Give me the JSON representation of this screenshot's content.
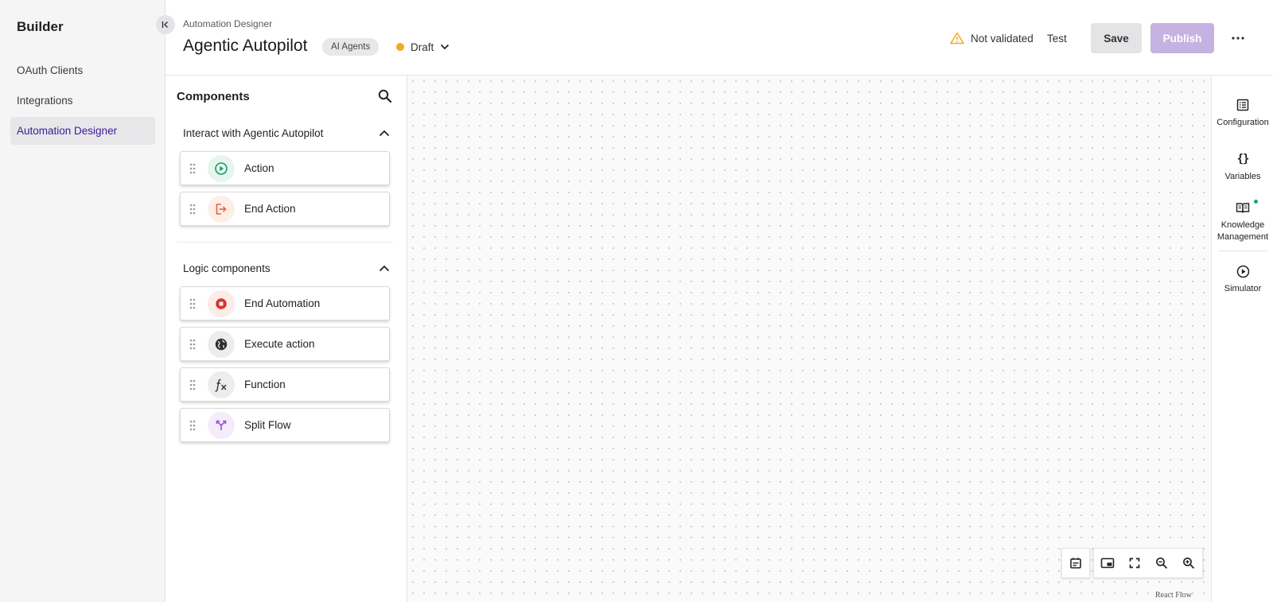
{
  "leftnav": {
    "brand": "Builder",
    "items": [
      {
        "label": "OAuth Clients",
        "active": false
      },
      {
        "label": "Integrations",
        "active": false
      },
      {
        "label": "Automation Designer",
        "active": true
      }
    ]
  },
  "header": {
    "breadcrumb": "Automation Designer",
    "title": "Agentic Autopilot",
    "tag": "AI Agents",
    "status": "Draft",
    "validation": "Not validated",
    "test_label": "Test",
    "save_label": "Save",
    "publish_label": "Publish"
  },
  "panel": {
    "title": "Components",
    "sections": [
      {
        "title": "Interact with Agentic Autopilot",
        "items": [
          {
            "label": "Action",
            "icon": "play-circle-icon"
          },
          {
            "label": "End Action",
            "icon": "exit-icon"
          }
        ]
      },
      {
        "title": "Logic components",
        "items": [
          {
            "label": "End Automation",
            "icon": "stop-icon"
          },
          {
            "label": "Execute action",
            "icon": "globe-icon"
          },
          {
            "label": "Function",
            "icon": "function-icon"
          },
          {
            "label": "Split Flow",
            "icon": "split-icon"
          }
        ]
      }
    ]
  },
  "canvas": {
    "attribution": "React Flow"
  },
  "rail": {
    "items": [
      {
        "label": "Configuration",
        "icon": "list-icon"
      },
      {
        "label": "Variables",
        "icon": "braces-icon"
      },
      {
        "label": "Knowledge Management",
        "icon": "book-icon"
      },
      {
        "label": "Simulator",
        "icon": "play-icon"
      }
    ]
  },
  "colors": {
    "accent": "#3b1d8f",
    "publish": "#c6b2e2",
    "draft": "#f2a91e",
    "action": "#1a9a6c",
    "end_action": "#e8663c",
    "end_automation": "#d8342b",
    "split": "#9b4fd6"
  }
}
